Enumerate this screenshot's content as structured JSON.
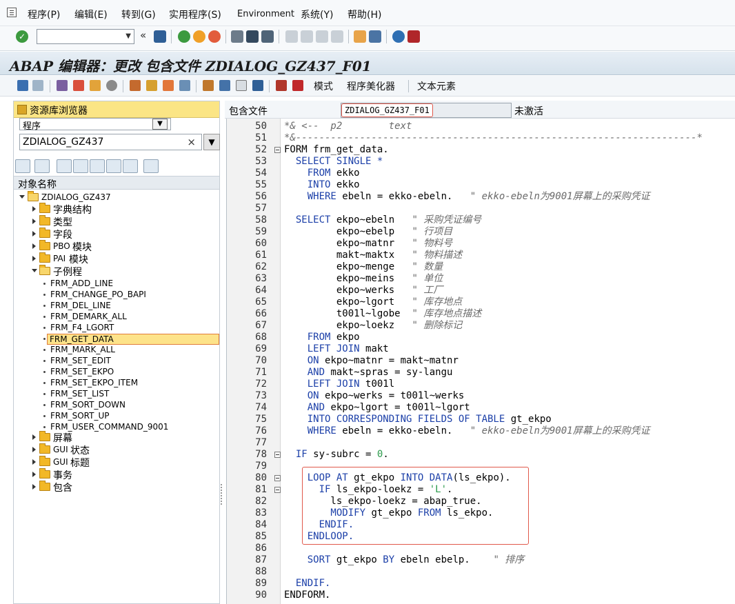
{
  "menu": {
    "items": [
      "程序(P)",
      "编辑(E)",
      "转到(G)",
      "实用程序(S)",
      "Environment",
      "系统(Y)",
      "帮助(H)"
    ]
  },
  "system_toolbar": {
    "command_field_value": "",
    "icons": [
      "enter-icon",
      "save-icon",
      "back-icon",
      "exit-icon",
      "cancel-icon",
      "print-icon",
      "find-icon",
      "find-next-icon",
      "first-page-icon",
      "prev-page-icon",
      "next-page-icon",
      "last-page-icon",
      "new-session-icon",
      "shortcut-icon",
      "help-icon",
      "customize-icon"
    ]
  },
  "title": "ABAP 编辑器：更改 包含文件 ZDIALOG_GZ437_F01",
  "app_toolbar": {
    "mode_label": "模式",
    "pretty_printer_label": "程序美化器",
    "text_elements_label": "文本元素"
  },
  "left_panel": {
    "header": "资源库浏览器",
    "object_type": "程序",
    "object_name": "ZDIALOG_GZ437",
    "column_header": "对象名称",
    "tree": {
      "root": "ZDIALOG_GZ437",
      "nodes": [
        {
          "label": "字典结构",
          "small_prefix": ""
        },
        {
          "label": "类型",
          "small_prefix": ""
        },
        {
          "label": "字段",
          "small_prefix": ""
        },
        {
          "label": "模块",
          "small_prefix": "PBO"
        },
        {
          "label": "模块",
          "small_prefix": "PAI"
        },
        {
          "label": "子例程",
          "small_prefix": ""
        }
      ],
      "subroutines": [
        "FRM_ADD_LINE",
        "FRM_CHANGE_PO_BAPI",
        "FRM_DEL_LINE",
        "FRM_DEMARK_ALL",
        "FRM_F4_LGORT",
        "FRM_GET_DATA",
        "FRM_MARK_ALL",
        "FRM_SET_EDIT",
        "FRM_SET_EKPO",
        "FRM_SET_EKPO_ITEM",
        "FRM_SET_LIST",
        "FRM_SORT_DOWN",
        "FRM_SORT_UP",
        "FRM_USER_COMMAND_9001"
      ],
      "selected_subroutine": "FRM_GET_DATA",
      "after_nodes": [
        {
          "label": "屏幕",
          "small_prefix": ""
        },
        {
          "label": "状态",
          "small_prefix": "GUI"
        },
        {
          "label": "标题",
          "small_prefix": "GUI"
        },
        {
          "label": "事务",
          "small_prefix": ""
        },
        {
          "label": "包含",
          "small_prefix": ""
        }
      ]
    }
  },
  "editor": {
    "include_label": "包含文件",
    "include_name": "ZDIALOG_GZ437_F01",
    "status": "未激活",
    "line_numbers": [
      "50",
      "51",
      "52",
      "53",
      "54",
      "55",
      "56",
      "57",
      "58",
      "59",
      "60",
      "61",
      "62",
      "63",
      "64",
      "65",
      "66",
      "67",
      "68",
      "69",
      "70",
      "71",
      "72",
      "73",
      "74",
      "75",
      "76",
      "77",
      "78",
      "79",
      "80",
      "81",
      "82",
      "83",
      "84",
      "85",
      "86",
      "87",
      "88",
      "89",
      "90"
    ],
    "lines": [
      [
        {
          "t": "*& <--  p2        text",
          "c": "cm"
        }
      ],
      [
        {
          "t": "*&---------------------------------------------------------------------*",
          "c": "cm"
        }
      ],
      [
        {
          "t": "FORM ",
          "c": ""
        },
        {
          "t": "frm_get_data.",
          "c": ""
        }
      ],
      [
        {
          "t": "  SELECT SINGLE *",
          "c": "kw"
        }
      ],
      [
        {
          "t": "    FROM ",
          "c": "kw"
        },
        {
          "t": "ekko",
          "c": ""
        }
      ],
      [
        {
          "t": "    INTO ",
          "c": "kw"
        },
        {
          "t": "ekko",
          "c": ""
        }
      ],
      [
        {
          "t": "    WHERE ",
          "c": "kw"
        },
        {
          "t": "ebeln = ekko-ebeln.   ",
          "c": ""
        },
        {
          "t": "\" ekko-ebeln为9001屏幕上的采购凭证",
          "c": "cm"
        }
      ],
      [
        {
          "t": "",
          "c": ""
        }
      ],
      [
        {
          "t": "  SELECT ",
          "c": "kw"
        },
        {
          "t": "ekpo~ebeln   ",
          "c": ""
        },
        {
          "t": "\" 采购凭证编号",
          "c": "cm"
        }
      ],
      [
        {
          "t": "         ekpo~ebelp   ",
          "c": ""
        },
        {
          "t": "\" 行项目",
          "c": "cm"
        }
      ],
      [
        {
          "t": "         ekpo~matnr   ",
          "c": ""
        },
        {
          "t": "\" 物料号",
          "c": "cm"
        }
      ],
      [
        {
          "t": "         makt~maktx   ",
          "c": ""
        },
        {
          "t": "\" 物料描述",
          "c": "cm"
        }
      ],
      [
        {
          "t": "         ekpo~menge   ",
          "c": ""
        },
        {
          "t": "\" 数量",
          "c": "cm"
        }
      ],
      [
        {
          "t": "         ekpo~meins   ",
          "c": ""
        },
        {
          "t": "\" 单位",
          "c": "cm"
        }
      ],
      [
        {
          "t": "         ekpo~werks   ",
          "c": ""
        },
        {
          "t": "\" 工厂",
          "c": "cm"
        }
      ],
      [
        {
          "t": "         ekpo~lgort   ",
          "c": ""
        },
        {
          "t": "\" 库存地点",
          "c": "cm"
        }
      ],
      [
        {
          "t": "         t001l~lgobe  ",
          "c": ""
        },
        {
          "t": "\" 库存地点描述",
          "c": "cm"
        }
      ],
      [
        {
          "t": "         ekpo~loekz   ",
          "c": ""
        },
        {
          "t": "\" 删除标记",
          "c": "cm"
        }
      ],
      [
        {
          "t": "    FROM ",
          "c": "kw"
        },
        {
          "t": "ekpo",
          "c": ""
        }
      ],
      [
        {
          "t": "    LEFT JOIN ",
          "c": "kw"
        },
        {
          "t": "makt",
          "c": ""
        }
      ],
      [
        {
          "t": "    ON ",
          "c": "kw"
        },
        {
          "t": "ekpo~matnr = makt~matnr",
          "c": ""
        }
      ],
      [
        {
          "t": "    AND ",
          "c": "kw"
        },
        {
          "t": "makt~spras = sy-langu",
          "c": ""
        }
      ],
      [
        {
          "t": "    LEFT JOIN ",
          "c": "kw"
        },
        {
          "t": "t001l",
          "c": ""
        }
      ],
      [
        {
          "t": "    ON ",
          "c": "kw"
        },
        {
          "t": "ekpo~werks = t001l~werks",
          "c": ""
        }
      ],
      [
        {
          "t": "    AND ",
          "c": "kw"
        },
        {
          "t": "ekpo~lgort = t001l~lgort",
          "c": ""
        }
      ],
      [
        {
          "t": "    INTO CORRESPONDING FIELDS OF TABLE ",
          "c": "kw"
        },
        {
          "t": "gt_ekpo",
          "c": ""
        }
      ],
      [
        {
          "t": "    WHERE ",
          "c": "kw"
        },
        {
          "t": "ebeln = ekko-ebeln.   ",
          "c": ""
        },
        {
          "t": "\" ekko-ebeln为9001屏幕上的采购凭证",
          "c": "cm"
        }
      ],
      [
        {
          "t": "",
          "c": ""
        }
      ],
      [
        {
          "t": "  IF ",
          "c": "kw"
        },
        {
          "t": "sy-subrc = ",
          "c": ""
        },
        {
          "t": "0",
          "c": "num"
        },
        {
          "t": ".",
          "c": ""
        }
      ],
      [
        {
          "t": "",
          "c": ""
        }
      ],
      [
        {
          "t": "    LOOP AT ",
          "c": "kw"
        },
        {
          "t": "gt_ekpo ",
          "c": ""
        },
        {
          "t": "INTO DATA",
          "c": "kw"
        },
        {
          "t": "(ls_ekpo).",
          "c": ""
        }
      ],
      [
        {
          "t": "      IF ",
          "c": "kw"
        },
        {
          "t": "ls_ekpo-loekz = ",
          "c": ""
        },
        {
          "t": "'L'",
          "c": "str"
        },
        {
          "t": ".",
          "c": ""
        }
      ],
      [
        {
          "t": "        ls_ekpo-loekz = abap_true.",
          "c": ""
        }
      ],
      [
        {
          "t": "        MODIFY ",
          "c": "kw"
        },
        {
          "t": "gt_ekpo ",
          "c": ""
        },
        {
          "t": "FROM ",
          "c": "kw"
        },
        {
          "t": "ls_ekpo.",
          "c": ""
        }
      ],
      [
        {
          "t": "      ENDIF.",
          "c": "kw"
        }
      ],
      [
        {
          "t": "    ENDLOOP.",
          "c": "kw"
        }
      ],
      [
        {
          "t": "",
          "c": ""
        }
      ],
      [
        {
          "t": "    SORT ",
          "c": "kw"
        },
        {
          "t": "gt_ekpo ",
          "c": ""
        },
        {
          "t": "BY ",
          "c": "kw"
        },
        {
          "t": "ebeln ebelp.    ",
          "c": ""
        },
        {
          "t": "\" 排序",
          "c": "cm"
        }
      ],
      [
        {
          "t": "",
          "c": ""
        }
      ],
      [
        {
          "t": "  ENDIF.",
          "c": "kw"
        }
      ],
      [
        {
          "t": "ENDFORM.",
          "c": ""
        }
      ]
    ]
  },
  "colors": {
    "keyword": "#1b3fa8",
    "comment": "#6a6a6a",
    "literal": "#2a9a4a",
    "highlight_border": "#e0584a",
    "selected_bg": "#fde38a"
  }
}
